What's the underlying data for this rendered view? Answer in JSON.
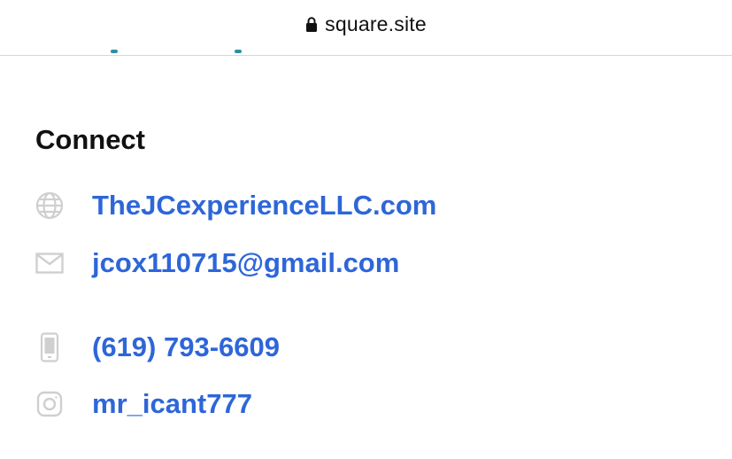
{
  "browser": {
    "url": "square.site",
    "lock_icon": "lock-icon"
  },
  "connect": {
    "title": "Connect",
    "accent_color": "#2e66d9",
    "items": [
      {
        "type": "website",
        "icon": "globe-icon",
        "label": "TheJCexperienceLLC.com"
      },
      {
        "type": "email",
        "icon": "envelope-icon",
        "label": "jcox110715@gmail.com"
      },
      {
        "type": "phone",
        "icon": "phone-icon",
        "label": "(619) 793-6609"
      },
      {
        "type": "instagram",
        "icon": "instagram-icon",
        "label": "mr_icant777"
      }
    ]
  }
}
